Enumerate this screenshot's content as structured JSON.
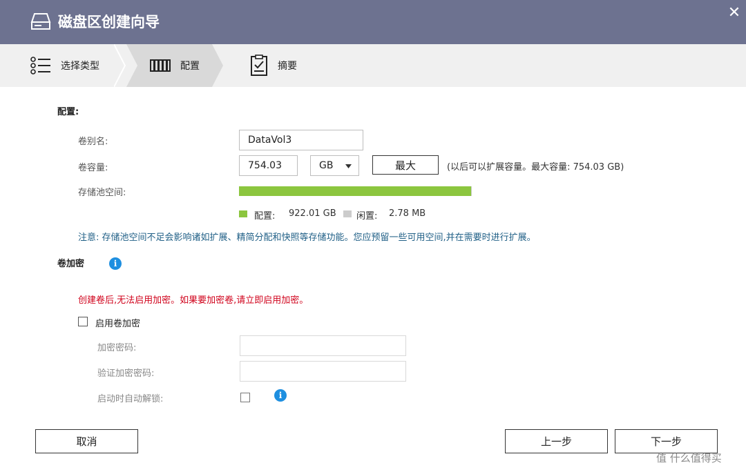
{
  "window": {
    "title": "磁盘区创建向导",
    "close_glyph": "✕"
  },
  "steps": [
    {
      "label": "选择类型",
      "icon": "list-icon"
    },
    {
      "label": "配置",
      "icon": "disk-bars-icon",
      "active": true
    },
    {
      "label": "摘要",
      "icon": "clipboard-icon"
    }
  ],
  "config": {
    "heading": "配置:",
    "volume_name_label": "卷别名:",
    "volume_name_value": "DataVol3",
    "capacity_label": "卷容量:",
    "capacity_value": "754.03",
    "unit_value": "GB",
    "max_button": "最大",
    "capacity_hint": "(以后可以扩展容量。最大容量: 754.03 GB)",
    "pool_space_label": "存储池空间:",
    "pool_bar_configured_fraction": 0.997,
    "colors": {
      "configured": "#8cc63f",
      "free": "#cccccc"
    },
    "legend": {
      "configured_label": "配置:",
      "configured_value": "922.01 GB",
      "free_label": "闲置:",
      "free_value": "2.78 MB"
    },
    "note": "注意: 存储池空间不足会影响诸如扩展、精简分配和快照等存储功能。您应预留一些可用空间,并在需要时进行扩展。"
  },
  "encryption": {
    "heading": "卷加密",
    "warning": "创建卷后,无法启用加密。如果要加密卷,请立即启用加密。",
    "enable_label": "启用卷加密",
    "password_label": "加密密码:",
    "confirm_label": "验证加密密码:",
    "auto_unlock_label": "启动时自动解锁:"
  },
  "footer": {
    "cancel": "取消",
    "back": "上一步",
    "next": "下一步"
  },
  "watermark": "值 什么值得买"
}
